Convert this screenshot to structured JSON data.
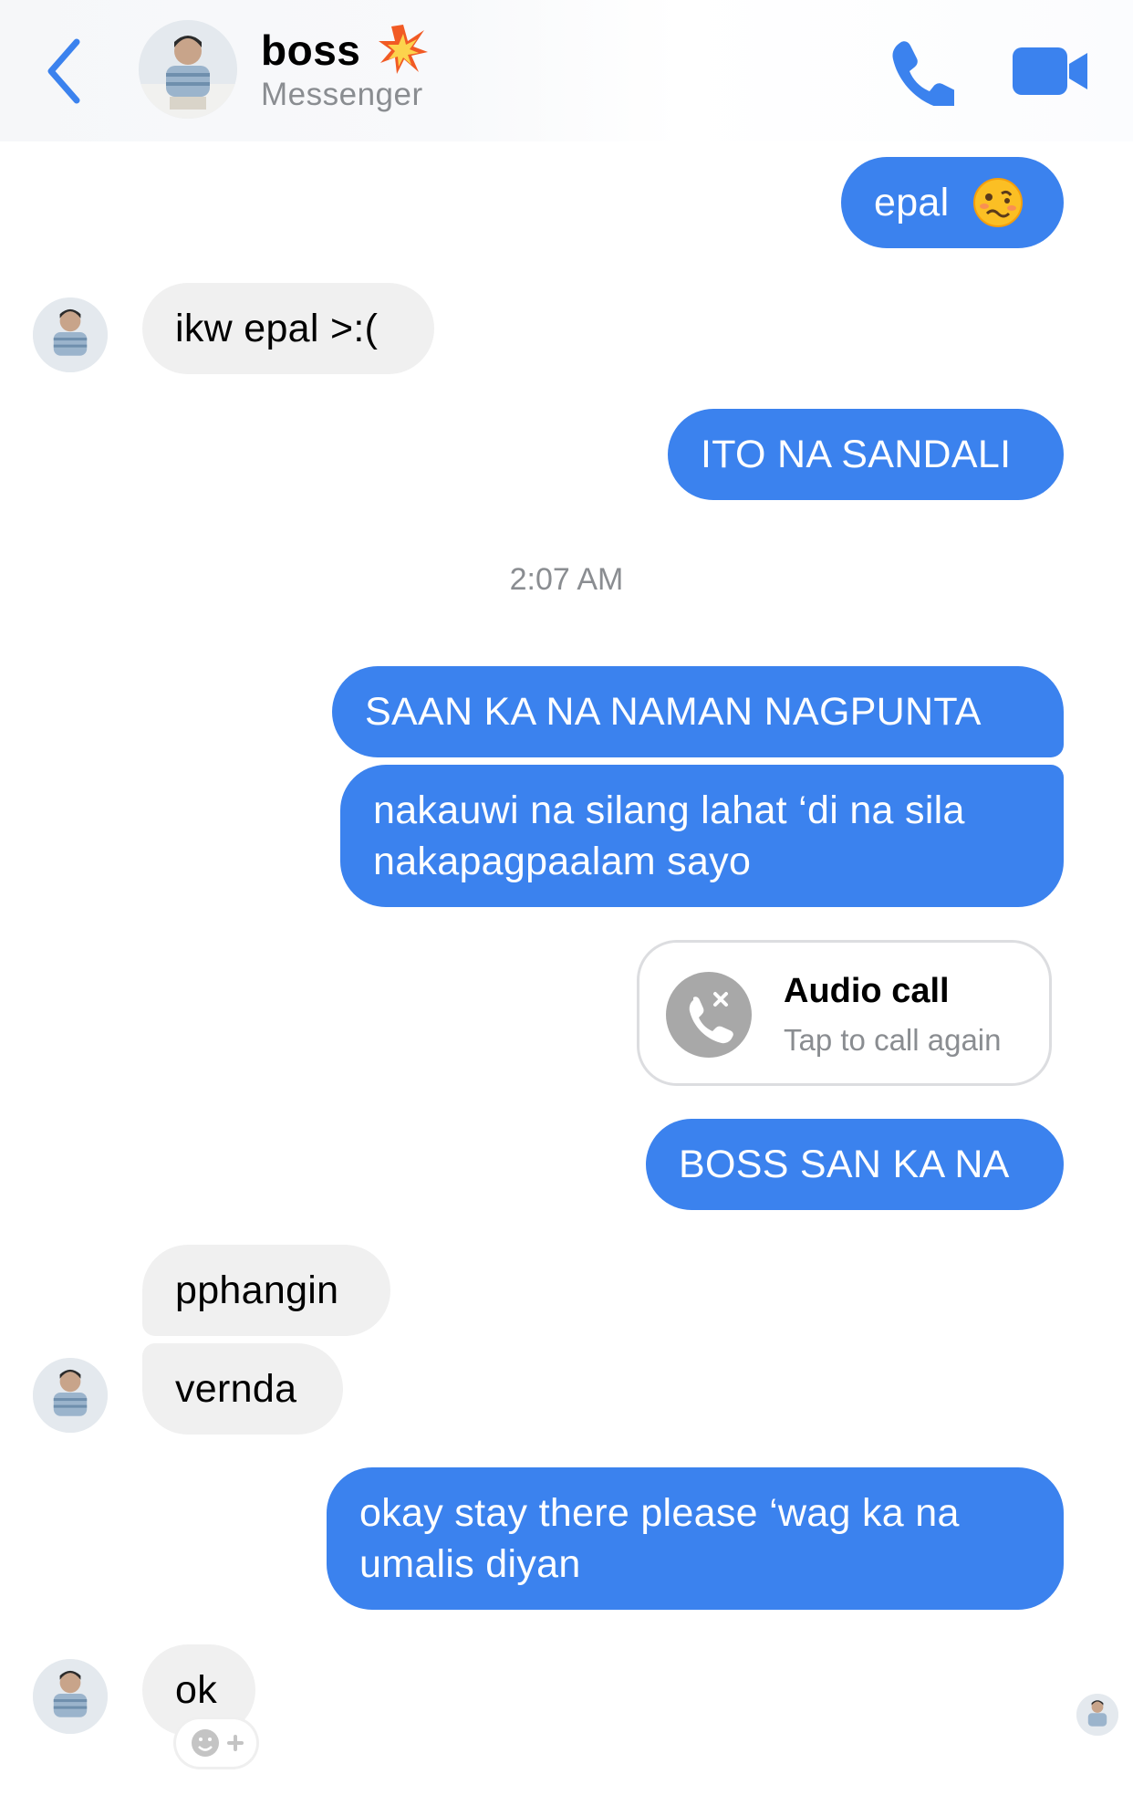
{
  "header": {
    "name": "boss",
    "subtitle": "Messenger",
    "name_emoji": "collision-emoji",
    "icons": [
      "back-chevron-icon",
      "phone-icon",
      "video-camera-icon"
    ],
    "accent_color": "#3b82ee"
  },
  "messages": [
    {
      "from": "me",
      "text": "epal",
      "emoji": "woozy-face-emoji"
    },
    {
      "from": "them",
      "text": "ikw epal >:("
    },
    {
      "from": "me",
      "text": "ITO NA SANDALI"
    },
    {
      "type": "timestamp",
      "text": "2:07 AM"
    },
    {
      "from": "me",
      "text": "SAAN KA NA NAMAN NAGPUNTA"
    },
    {
      "from": "me",
      "line1": "nakauwi na silang lahat ‘di na sila",
      "line2": "nakapagpaalam sayo"
    },
    {
      "type": "call",
      "title": "Audio call",
      "subtitle": "Tap to call again",
      "icon": "missed-call-icon"
    },
    {
      "from": "me",
      "text": "BOSS SAN KA NA"
    },
    {
      "from": "them",
      "text": "pphangin"
    },
    {
      "from": "them",
      "text": "vernda"
    },
    {
      "from": "me",
      "line1": "okay stay there please ‘wag ka na",
      "line2": "umalis diyan"
    },
    {
      "from": "them",
      "text": "ok",
      "reaction_button": "add-reaction-icon"
    }
  ],
  "colors": {
    "my_bubble": "#3b82ee",
    "their_bubble": "#f0f0f0",
    "secondary_text": "#8a8d91"
  }
}
